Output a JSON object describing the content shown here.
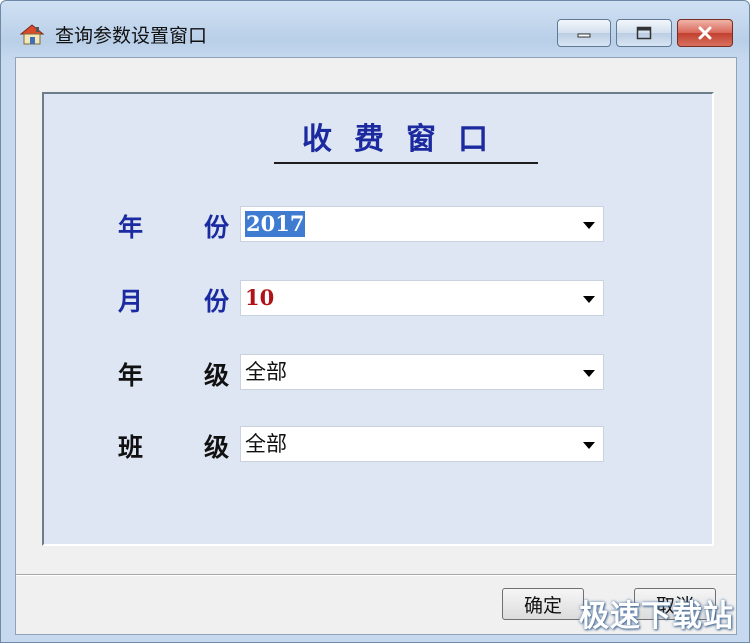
{
  "window": {
    "title": "查询参数设置窗口",
    "title_icon": "app-house-icon",
    "controls": {
      "minimize": "minimize-icon",
      "maximize": "maximize-icon",
      "close": "close-icon"
    }
  },
  "form": {
    "heading": "收费窗口",
    "fields": [
      {
        "label_a": "年",
        "label_b": "份",
        "value": "2017"
      },
      {
        "label_a": "月",
        "label_b": "份",
        "value": "10"
      },
      {
        "label_a": "年",
        "label_b": "级",
        "value": "全部"
      },
      {
        "label_a": "班",
        "label_b": "级",
        "value": "全部"
      }
    ]
  },
  "buttons": {
    "ok": "确定",
    "cancel": "取消"
  },
  "watermark": "极速下载站",
  "colors": {
    "heading": "#1c2aa0",
    "selection": "#3f7bd1",
    "month_value": "#b0121a",
    "panel": "#dde6f2"
  }
}
